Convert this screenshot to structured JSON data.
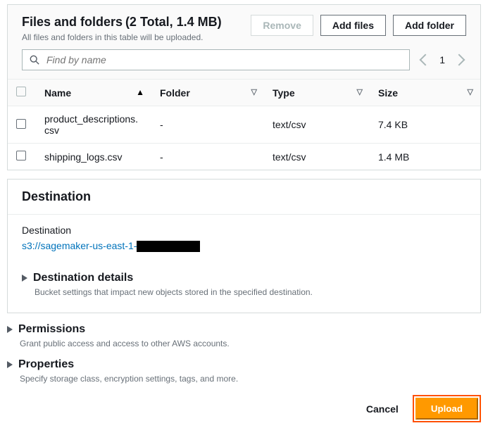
{
  "files_panel": {
    "title": "Files and folders",
    "summary": "(2 Total, 1.4 MB)",
    "subtitle": "All files and folders in this table will be uploaded.",
    "remove_label": "Remove",
    "add_files_label": "Add files",
    "add_folder_label": "Add folder",
    "search_placeholder": "Find by name",
    "page": "1",
    "columns": {
      "name": "Name",
      "folder": "Folder",
      "type": "Type",
      "size": "Size"
    },
    "rows": [
      {
        "name": "product_descriptions.csv",
        "folder": "-",
        "type": "text/csv",
        "size": "7.4 KB"
      },
      {
        "name": "shipping_logs.csv",
        "folder": "-",
        "type": "text/csv",
        "size": "1.4 MB"
      }
    ]
  },
  "destination_panel": {
    "heading": "Destination",
    "label": "Destination",
    "link_prefix": "s3://sagemaker-us-east-1",
    "details_title": "Destination details",
    "details_sub": "Bucket settings that impact new objects stored in the specified destination."
  },
  "permissions": {
    "title": "Permissions",
    "sub": "Grant public access and access to other AWS accounts."
  },
  "properties": {
    "title": "Properties",
    "sub": "Specify storage class, encryption settings, tags, and more."
  },
  "footer": {
    "cancel": "Cancel",
    "upload": "Upload"
  }
}
